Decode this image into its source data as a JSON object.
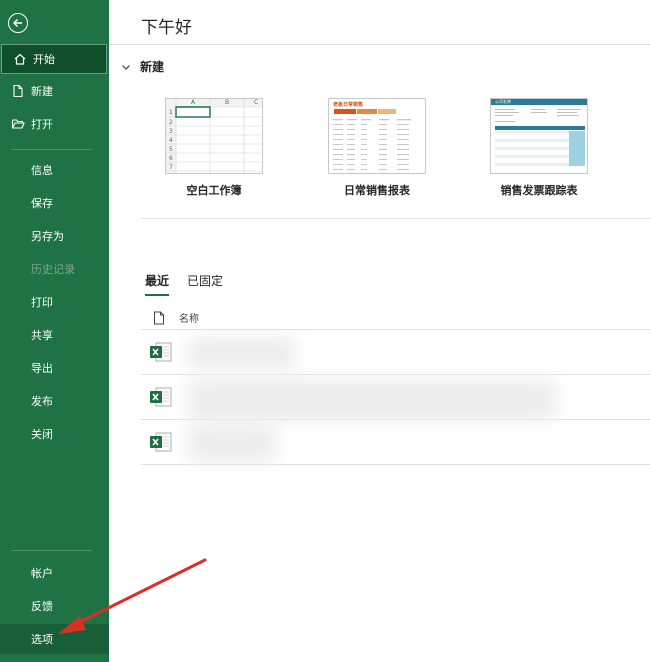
{
  "sidebar": {
    "items": [
      {
        "label": "开始"
      },
      {
        "label": "新建"
      },
      {
        "label": "打开"
      },
      {
        "label": "信息"
      },
      {
        "label": "保存"
      },
      {
        "label": "另存为"
      },
      {
        "label": "历史记录"
      },
      {
        "label": "打印"
      },
      {
        "label": "共享"
      },
      {
        "label": "导出"
      },
      {
        "label": "发布"
      },
      {
        "label": "关闭"
      },
      {
        "label": "帐户"
      },
      {
        "label": "反馈"
      },
      {
        "label": "选项"
      }
    ]
  },
  "main": {
    "greeting": "下午好",
    "new_section": "新建",
    "templates": [
      {
        "name": "空白工作簿"
      },
      {
        "name": "日常销售报表"
      },
      {
        "name": "销售发票跟踪表"
      }
    ],
    "blank_thumb": {
      "cols": [
        "A",
        "B",
        "C"
      ],
      "rows": [
        "1",
        "2",
        "3",
        "4",
        "5",
        "6",
        "7"
      ]
    },
    "sales_thumb": {
      "title": "老板日常销售"
    },
    "invoice_thumb": {
      "title": "公司名称"
    },
    "tabs": [
      {
        "label": "最近"
      },
      {
        "label": "已固定"
      }
    ],
    "list_header": {
      "name_col": "名称"
    }
  },
  "colors": {
    "sidebar": "#1f7244",
    "active": "#0f4f2b",
    "arrow": "#d93025"
  }
}
